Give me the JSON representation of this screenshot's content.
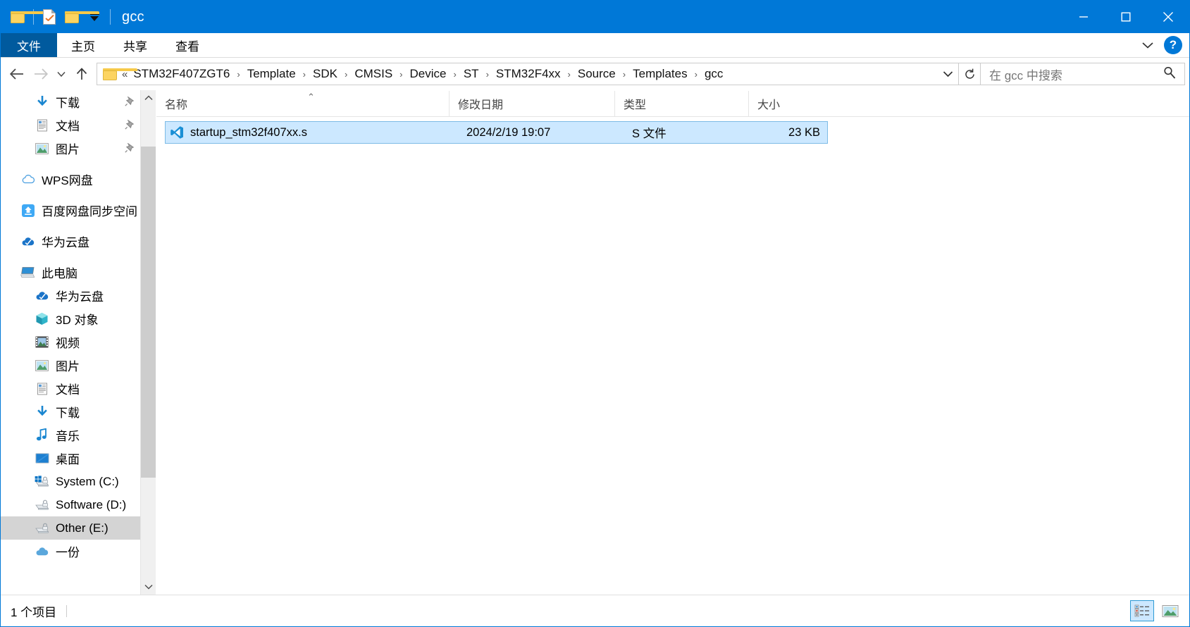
{
  "window": {
    "title": "gcc",
    "quick_access": [
      {
        "name": "folder-icon",
        "kind": "folder"
      },
      {
        "name": "properties-icon",
        "kind": "doc-check"
      },
      {
        "name": "new-folder-icon",
        "kind": "folder"
      },
      {
        "name": "customize-quick-access-toolbar-icon",
        "kind": "caret"
      }
    ],
    "controls": {
      "minimize": "—",
      "maximize": "□",
      "close": "✕"
    }
  },
  "ribbon": {
    "file_tab": "文件",
    "tabs": [
      "主页",
      "共享",
      "查看"
    ],
    "expand_icon": "chevron-down-icon",
    "help_label": "?"
  },
  "addressbar": {
    "back_icon": "←",
    "forward_icon": "→",
    "recent_icon": "∨",
    "up_icon": "↑",
    "overflow_chevrons": "«",
    "separator": "›",
    "breadcrumbs": [
      "STM32F407ZGT6",
      "Template",
      "SDK",
      "CMSIS",
      "Device",
      "ST",
      "STM32F4xx",
      "Source",
      "Templates",
      "gcc"
    ],
    "dropdown_icon": "⌄",
    "refresh_icon": "↻",
    "search_placeholder": "在 gcc 中搜索",
    "search_value": "",
    "search_icon": "search-icon"
  },
  "sidebar": {
    "groups": [
      {
        "items": [
          {
            "label": "下载",
            "icon": "download-icon",
            "indent": "child",
            "pinned": true
          },
          {
            "label": "文档",
            "icon": "documents-icon",
            "indent": "child",
            "pinned": true
          },
          {
            "label": "图片",
            "icon": "pictures-icon",
            "indent": "child",
            "pinned": true
          }
        ]
      },
      {
        "items": [
          {
            "label": "WPS网盘",
            "icon": "wps-cloud-icon",
            "indent": "root",
            "pinned": false
          }
        ]
      },
      {
        "items": [
          {
            "label": "百度网盘同步空间",
            "icon": "baidu-netdisk-icon",
            "indent": "root",
            "pinned": false
          }
        ]
      },
      {
        "items": [
          {
            "label": "华为云盘",
            "icon": "huawei-cloud-icon",
            "indent": "root",
            "pinned": false
          }
        ]
      },
      {
        "items": [
          {
            "label": "此电脑",
            "icon": "this-pc-icon",
            "indent": "root",
            "pinned": false
          },
          {
            "label": "华为云盘",
            "icon": "huawei-cloud-icon",
            "indent": "child",
            "pinned": false
          },
          {
            "label": "3D 对象",
            "icon": "3d-objects-icon",
            "indent": "child",
            "pinned": false
          },
          {
            "label": "视频",
            "icon": "videos-icon",
            "indent": "child",
            "pinned": false
          },
          {
            "label": "图片",
            "icon": "pictures-icon",
            "indent": "child",
            "pinned": false
          },
          {
            "label": "文档",
            "icon": "documents-icon",
            "indent": "child",
            "pinned": false
          },
          {
            "label": "下载",
            "icon": "download-icon",
            "indent": "child",
            "pinned": false
          },
          {
            "label": "音乐",
            "icon": "music-icon",
            "indent": "child",
            "pinned": false
          },
          {
            "label": "桌面",
            "icon": "desktop-icon",
            "indent": "child",
            "pinned": false
          },
          {
            "label": "System (C:)",
            "icon": "windows-drive-icon",
            "indent": "child",
            "pinned": false
          },
          {
            "label": "Software (D:)",
            "icon": "drive-icon",
            "indent": "child",
            "pinned": false
          },
          {
            "label": "Other (E:)",
            "icon": "drive-icon",
            "indent": "child",
            "pinned": false,
            "selected": true
          },
          {
            "label": "一份",
            "icon": "cloud-icon",
            "indent": "child",
            "pinned": false,
            "clipped": true
          }
        ]
      }
    ],
    "scroll": {
      "up_icon": "⌃",
      "down_icon": "⌄"
    }
  },
  "filelist": {
    "columns": [
      {
        "key": "name",
        "label": "名称",
        "sorted": "asc"
      },
      {
        "key": "date",
        "label": "修改日期"
      },
      {
        "key": "type",
        "label": "类型"
      },
      {
        "key": "size",
        "label": "大小"
      }
    ],
    "sort_indicator": "⌃",
    "rows": [
      {
        "name": "startup_stm32f407xx.s",
        "date": "2024/2/19 19:07",
        "type": "S 文件",
        "size": "23 KB",
        "icon": "vscode-file-icon",
        "selected": true
      }
    ]
  },
  "statusbar": {
    "item_count": "1 个项目",
    "views": [
      {
        "name": "details-view-button",
        "active": true
      },
      {
        "name": "large-icons-view-button",
        "active": false
      }
    ]
  },
  "colors": {
    "accent": "#0078d7",
    "file_tab": "#005a9e",
    "selection_fill": "#cce8ff",
    "selection_border": "#7dbbe6",
    "nav_selection": "#d4d4d4",
    "scroll_thumb": "#cdcdcd"
  }
}
